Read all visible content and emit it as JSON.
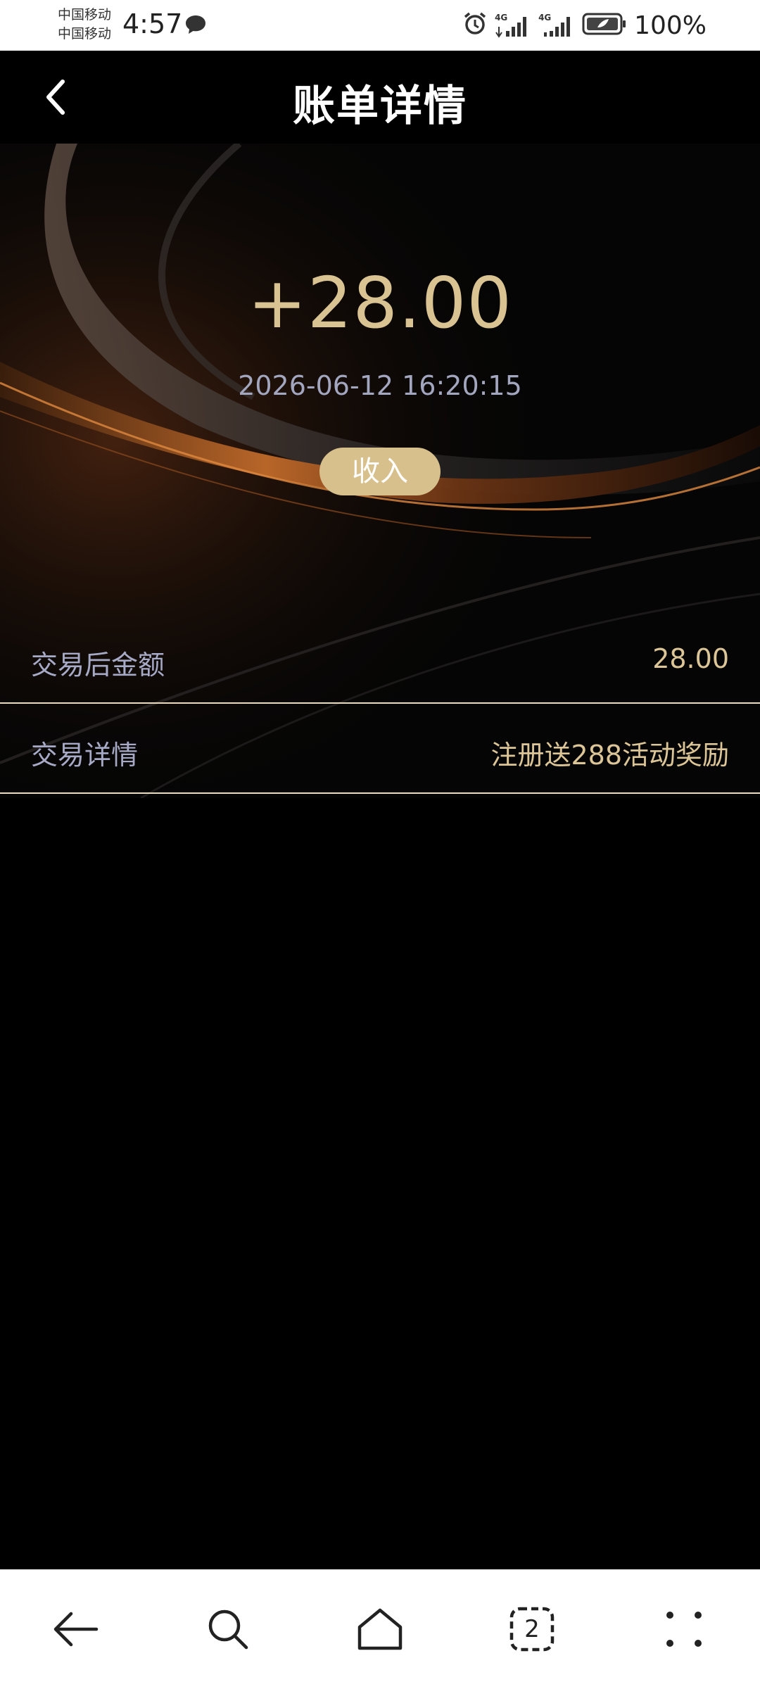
{
  "status_bar": {
    "carrier_1": "中国移动",
    "carrier_2": "中国移动",
    "time": "4:57",
    "network_1": "4G",
    "network_2": "4G",
    "battery": "100%"
  },
  "header": {
    "title": "账单详情"
  },
  "transaction": {
    "amount": "+28.00",
    "datetime": "2026-06-12 16:20:15",
    "type": "收入"
  },
  "details": [
    {
      "label": "交易后金额",
      "value": "28.00"
    },
    {
      "label": "交易详情",
      "value": "注册送288活动奖励"
    }
  ],
  "bottom_nav": {
    "tab_count": "2"
  },
  "colors": {
    "gold": "#d9c393",
    "badge_gold": "#d7c08c",
    "muted_label": "#a7aac6",
    "background": "#000000"
  }
}
